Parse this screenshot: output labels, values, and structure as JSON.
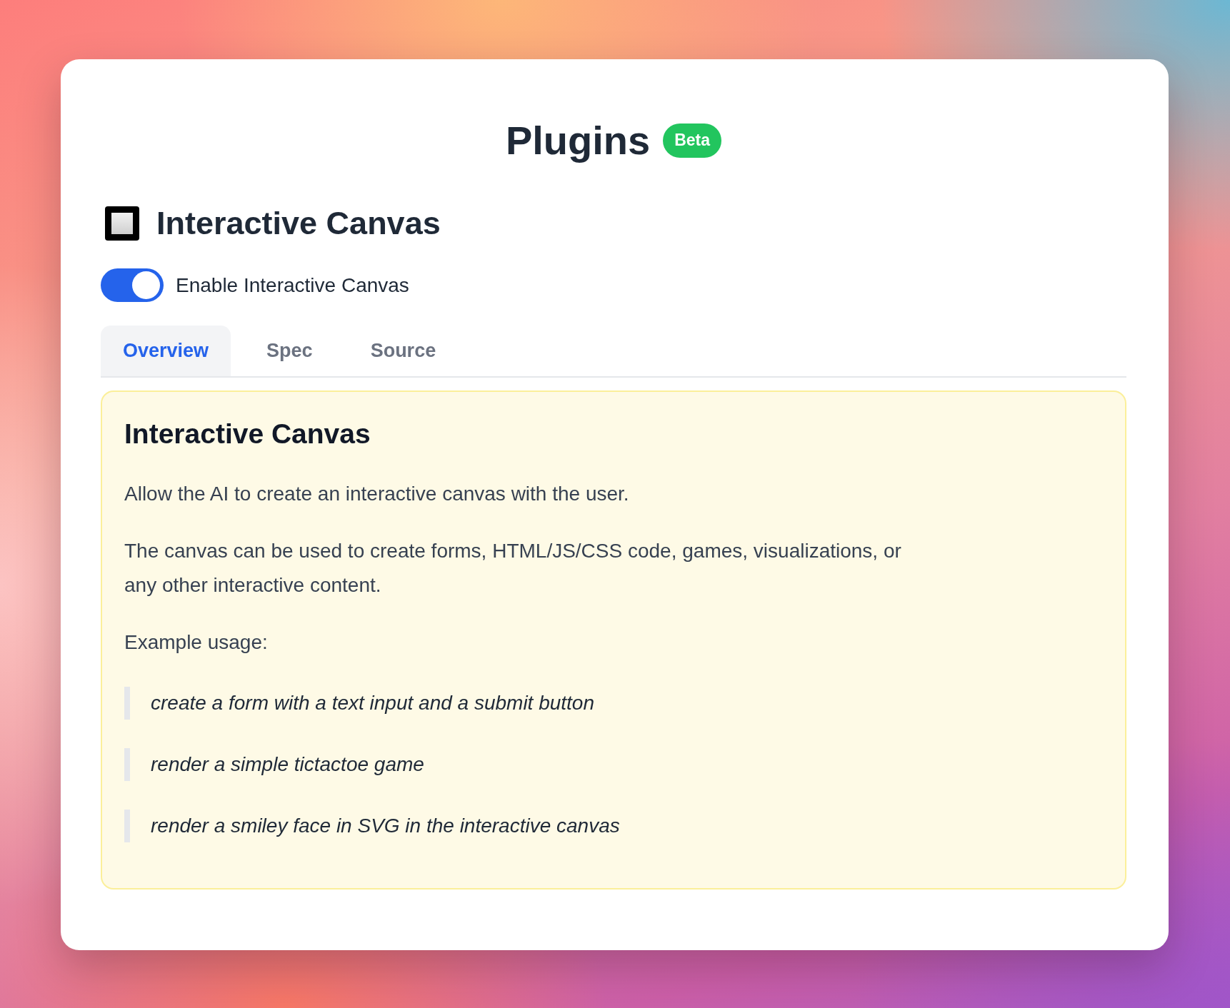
{
  "title": "Plugins",
  "badge": "Beta",
  "plugin": {
    "name": "Interactive Canvas",
    "toggle": {
      "label": "Enable Interactive Canvas",
      "on": true
    }
  },
  "tabs": [
    {
      "label": "Overview",
      "selected": true
    },
    {
      "label": "Spec",
      "selected": false
    },
    {
      "label": "Source",
      "selected": false
    }
  ],
  "overview": {
    "heading": "Interactive Canvas",
    "paragraphs": [
      "Allow the AI to create an interactive canvas with the user.",
      "The canvas can be used to create forms, HTML/JS/CSS code, games, visualizations, or any other interactive content."
    ],
    "examples_label": "Example usage:",
    "examples": [
      "create a form with a text input and a submit button",
      "render a simple tictactoe game",
      "render a smiley face in SVG in the interactive canvas"
    ]
  }
}
